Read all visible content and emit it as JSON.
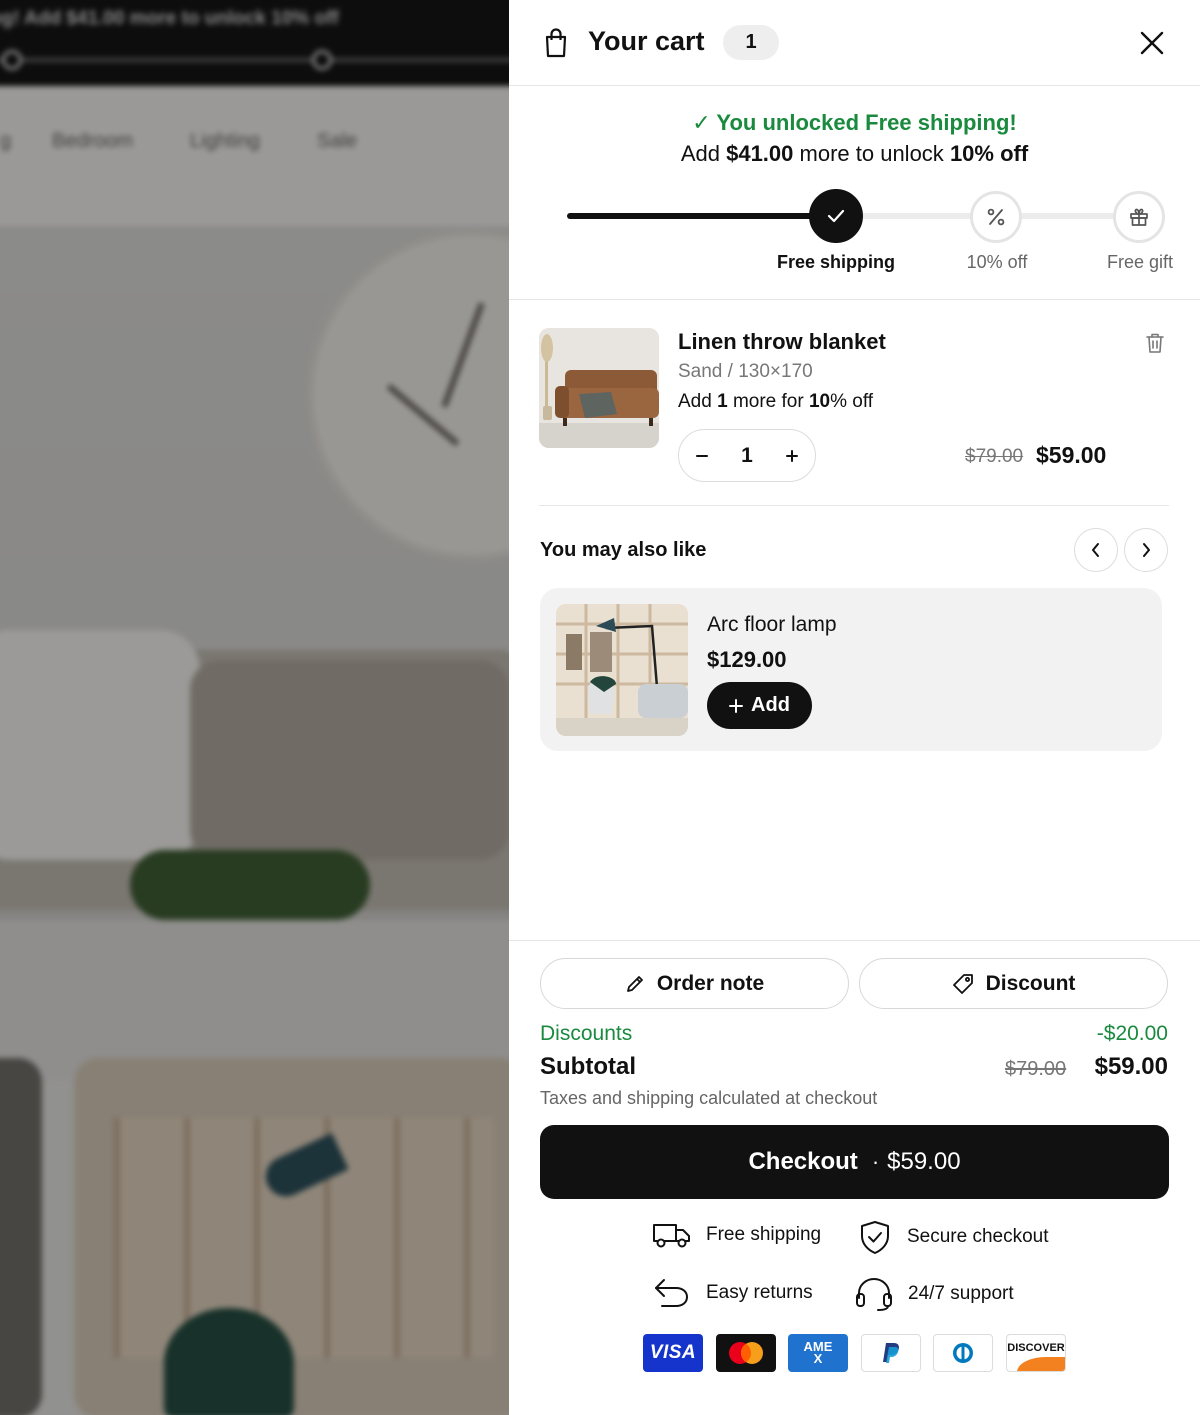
{
  "background": {
    "announcement": "ng! Add $41.00 more to unlock 10% off",
    "nav_items": [
      "g",
      "Bedroom",
      "Lighting",
      "Sale"
    ]
  },
  "cart": {
    "title": "Your cart",
    "count": "1",
    "progress": {
      "unlocked_message": "✓ You unlocked Free shipping!",
      "add_prefix": "Add",
      "add_amount": "$41.00",
      "add_middle": "more to unlock",
      "add_target": "10% off",
      "fill_fraction": 0.47,
      "milestones": [
        {
          "label": "Free shipping",
          "icon": "check-icon",
          "done": true
        },
        {
          "label": "10% off",
          "icon": "percent-icon",
          "done": false
        },
        {
          "label": "Free gift",
          "icon": "gift-icon",
          "done": false
        }
      ]
    },
    "item": {
      "name": "Linen throw blanket",
      "variant": "Sand / 130×170",
      "upsell_prefix": "Add",
      "upsell_qty": "1",
      "upsell_middle": "more for",
      "upsell_bold": "10",
      "upsell_suffix": "% off",
      "quantity": "1",
      "compare_price": "$79.00",
      "price": "$59.00"
    },
    "recommendations": {
      "title": "You may also like",
      "product": {
        "name": "Arc floor lamp",
        "price": "$129.00",
        "add_label": "Add"
      }
    },
    "footer": {
      "order_note_label": "Order note",
      "discount_label": "Discount",
      "discounts_label": "Discounts",
      "discounts_value": "-$20.00",
      "subtotal_label": "Subtotal",
      "subtotal_compare": "$79.00",
      "subtotal_value": "$59.00",
      "tax_note": "Taxes and shipping calculated at checkout",
      "checkout_label": "Checkout",
      "checkout_separator": "·",
      "checkout_amount": "$59.00",
      "trust": {
        "free_shipping": "Free shipping",
        "secure_checkout": "Secure checkout",
        "easy_returns": "Easy returns",
        "support": "24/7 support"
      },
      "payment_methods": {
        "visa": "VISA",
        "amex": "AMEX",
        "discover": "DISCOVER"
      }
    }
  },
  "colors": {
    "success": "#1a8a3e",
    "primary": "#111111",
    "muted": "#777777"
  }
}
